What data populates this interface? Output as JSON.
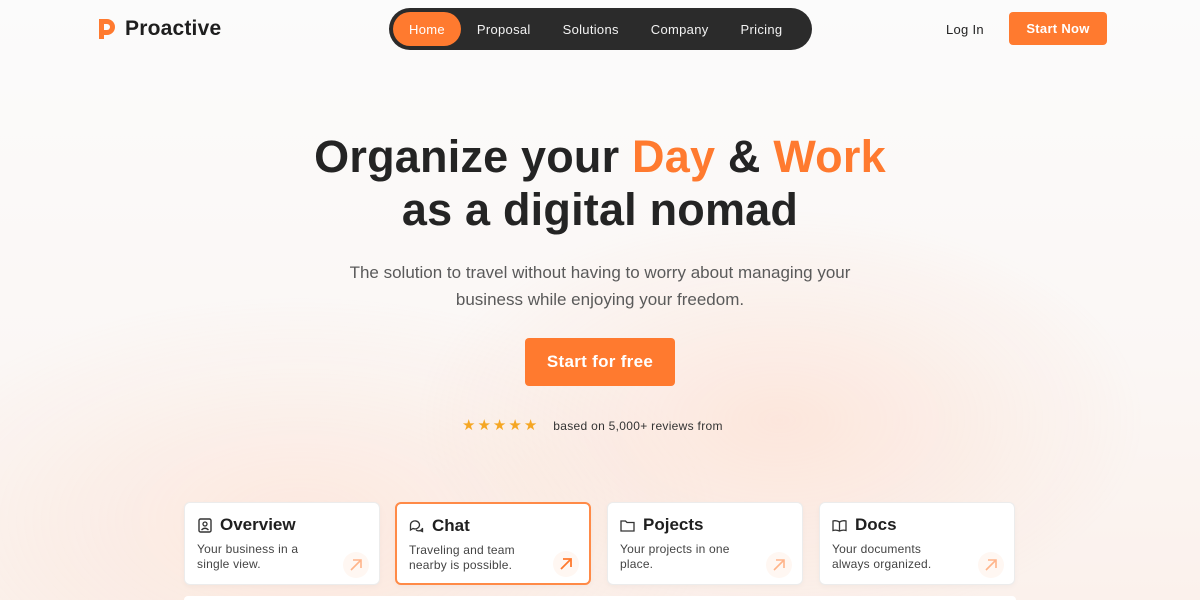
{
  "brand": {
    "name": "Proactive",
    "accent": "#ff7a2f"
  },
  "nav": {
    "items": [
      {
        "label": "Home",
        "active": true
      },
      {
        "label": "Proposal",
        "active": false
      },
      {
        "label": "Solutions",
        "active": false
      },
      {
        "label": "Company",
        "active": false
      },
      {
        "label": "Pricing",
        "active": false
      }
    ]
  },
  "header": {
    "login_label": "Log In",
    "start_label": "Start Now"
  },
  "hero": {
    "title_part1": "Organize your ",
    "title_day": "Day",
    "title_amp": " & ",
    "title_work": "Work",
    "title_line2": "as a digital nomad",
    "subtitle": "The solution to travel without having to worry about managing your business while enjoying your freedom.",
    "cta_label": "Start for free",
    "rating": 5,
    "reviews_text": "based on 5,000+ reviews from"
  },
  "cards": [
    {
      "title": "Overview",
      "desc": "Your business in a single view.",
      "icon": "profile-icon"
    },
    {
      "title": "Chat",
      "desc": "Traveling and team nearby is possible.",
      "icon": "chat-icon"
    },
    {
      "title": "Pojects",
      "desc": "Your projects in one place.",
      "icon": "folder-icon"
    },
    {
      "title": "Docs",
      "desc": "Your documents always organized.",
      "icon": "book-icon"
    }
  ]
}
